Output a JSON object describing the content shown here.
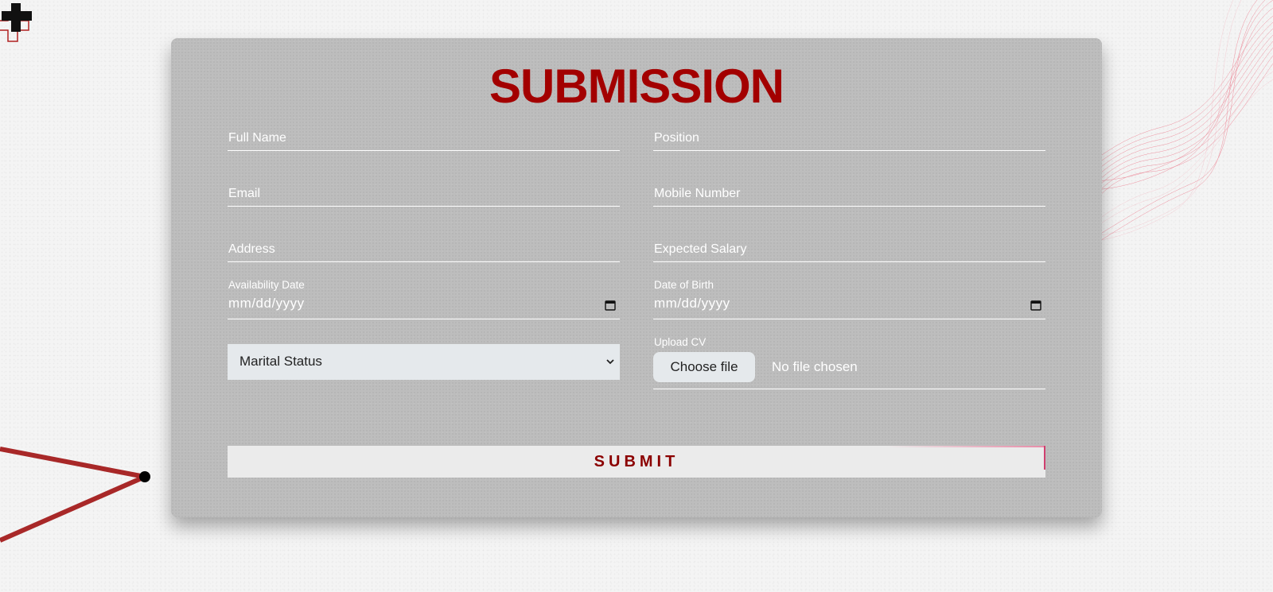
{
  "form": {
    "title": "SUBMISSION",
    "fields": {
      "full_name": {
        "placeholder": "Full Name"
      },
      "position": {
        "placeholder": "Position"
      },
      "email": {
        "placeholder": "Email"
      },
      "mobile": {
        "placeholder": "Mobile Number"
      },
      "address": {
        "placeholder": "Address"
      },
      "salary": {
        "placeholder": "Expected Salary"
      },
      "availability": {
        "label": "Availability Date",
        "value": "mm/dd/yyyy"
      },
      "dob": {
        "label": "Date of Birth",
        "value": "mm/dd/yyyy"
      },
      "marital": {
        "selected": "Marital Status"
      },
      "cv": {
        "label": "Upload CV",
        "button": "Choose file",
        "status": "No file chosen"
      }
    },
    "submit_label": "SUBMIT"
  },
  "icons": {
    "date": "calendar-icon",
    "select": "chevron-down-icon"
  },
  "colors": {
    "title": "#a30000",
    "submit_text": "#8b0000",
    "card": "#bdbdbd",
    "field_line": "#ffffff",
    "accent_wave": "#e8405a"
  }
}
